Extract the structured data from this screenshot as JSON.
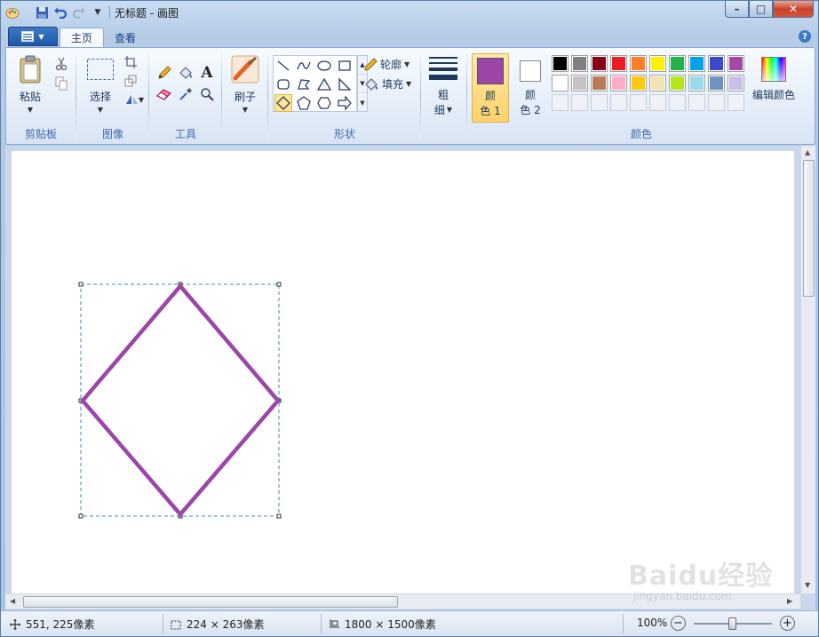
{
  "window": {
    "title": "无标题 - 画图",
    "controls": {
      "minimize": "–",
      "maximize": "□",
      "close": "✕"
    }
  },
  "ribbon": {
    "tabs": [
      {
        "label": "主页",
        "active": true
      },
      {
        "label": "查看",
        "active": false
      }
    ],
    "help": "?",
    "groups": {
      "clipboard": {
        "label": "剪贴板",
        "paste": "粘贴"
      },
      "image": {
        "label": "图像",
        "select": "选择"
      },
      "tools": {
        "label": "工具",
        "text_icon": "A"
      },
      "brushes": {
        "label": "刷子"
      },
      "shapes": {
        "label": "形状",
        "outline": "轮廓",
        "fill": "填充"
      },
      "size": {
        "line1": "粗",
        "line2": "细"
      },
      "colors": {
        "label": "颜色",
        "color1_line1": "颜",
        "color1_line2": "色 1",
        "color2_line1": "颜",
        "color2_line2": "色 2",
        "edit_colors": "编辑颜色",
        "color1_value": "#9b46a8",
        "color2_value": "#ffffff",
        "palette_row1": [
          "#000000",
          "#7f7f7f",
          "#880015",
          "#ed1c24",
          "#ff7f27",
          "#fff200",
          "#22b14c",
          "#00a2e8",
          "#3f48cc",
          "#a349a4"
        ],
        "palette_row2": [
          "#ffffff",
          "#c3c3c3",
          "#b97a57",
          "#ffaec9",
          "#ffc90e",
          "#efe4b0",
          "#b5e61d",
          "#99d9ea",
          "#7092be",
          "#c8bfe7"
        ]
      }
    }
  },
  "canvas": {
    "shape": "diamond",
    "stroke_color": "#9b46a8"
  },
  "status": {
    "cursor": "551, 225像素",
    "selection": "224 × 263像素",
    "image_size": "1800 × 1500像素",
    "zoom": "100%",
    "zoom_out": "−",
    "zoom_in": "+"
  },
  "watermark": {
    "text": "Baidu经验",
    "sub": "jingyan.baidu.com"
  }
}
